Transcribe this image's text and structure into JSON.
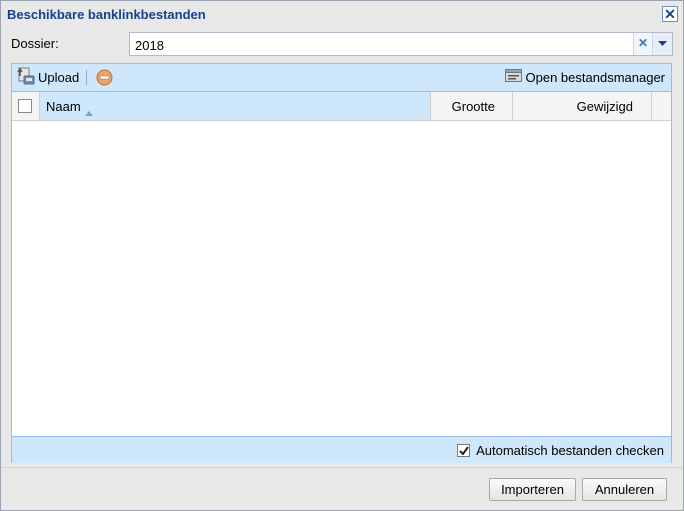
{
  "dialog": {
    "title": "Beschikbare banklinkbestanden",
    "close_icon": "close-icon"
  },
  "dossier": {
    "label": "Dossier:",
    "value": "2018",
    "clear_icon": "clear-icon",
    "dropdown_icon": "chevron-down-icon"
  },
  "toolbar": {
    "upload_label": "Upload",
    "upload_icon": "upload-icon",
    "remove_icon": "remove-icon",
    "manager_label": "Open bestandsmanager",
    "manager_icon": "file-manager-icon"
  },
  "grid": {
    "columns": [
      {
        "label": "Naam",
        "sorted": "ascending"
      },
      {
        "label": "Grootte"
      },
      {
        "label": "Gewijzigd"
      }
    ],
    "rows": []
  },
  "bottombar": {
    "auto_check_label": "Automatisch bestanden checken",
    "auto_check_checked": true
  },
  "buttons": {
    "import_label": "Importeren",
    "cancel_label": "Annuleren"
  },
  "colors": {
    "title": "#15428b",
    "toolbar_bg": "#cfe7fb",
    "border": "#99bbe8"
  }
}
